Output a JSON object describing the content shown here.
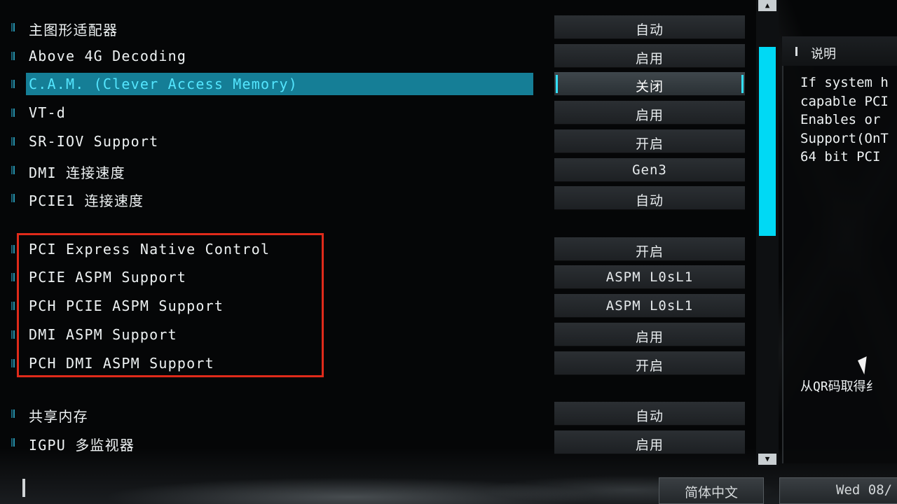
{
  "settings": [
    {
      "label": "主图形适配器",
      "value": "自动"
    },
    {
      "label": "Above 4G Decoding",
      "value": "启用"
    },
    {
      "label": "C.A.M. (Clever Access Memory)",
      "value": "关闭"
    },
    {
      "label": "VT-d",
      "value": "启用"
    },
    {
      "label": "SR-IOV Support",
      "value": "开启"
    },
    {
      "label": "DMI 连接速度",
      "value": "Gen3"
    },
    {
      "label": "PCIE1 连接速度",
      "value": "自动"
    },
    {
      "label": "PCI Express Native Control",
      "value": "开启"
    },
    {
      "label": "PCIE ASPM Support",
      "value": "ASPM L0sL1"
    },
    {
      "label": "PCH PCIE ASPM Support",
      "value": "ASPM L0sL1"
    },
    {
      "label": "DMI ASPM Support",
      "value": "启用"
    },
    {
      "label": "PCH DMI ASPM Support",
      "value": "开启"
    },
    {
      "label": "共享内存",
      "value": "自动"
    },
    {
      "label": "IGPU 多监视器",
      "value": "启用"
    }
  ],
  "description": {
    "title": "说明",
    "text": "If system h\ncapable PCI\nEnables or \nSupport(OnT\n64 bit PCI ",
    "qr": "从QR码取得纟"
  },
  "footer": {
    "language": "简体中文",
    "datetime": "Wed 08/"
  },
  "icons": {
    "scroll_up": "triangle-up-icon",
    "scroll_down": "triangle-down-icon",
    "cursor": "mouse-pointer-icon"
  },
  "colors": {
    "accent": "#00d9f5",
    "selected_row": "#157e96",
    "highlight_border": "#e02a1a"
  }
}
